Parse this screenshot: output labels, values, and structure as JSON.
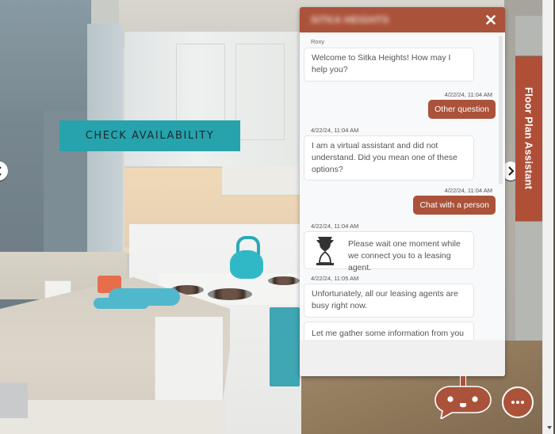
{
  "page": {
    "check_availability_label": "CHECK AVAILABILITY",
    "floor_plan_tab_label": "Floor Plan Assistant",
    "nav_prev_icon": "chevron-left-icon",
    "nav_next_icon": "chevron-right-icon"
  },
  "chat": {
    "title": "SITKA HEIGHTS",
    "close_icon": "close-icon",
    "colors": {
      "brand": "#ab523a",
      "accent": "#26a3ad"
    },
    "messages": [
      {
        "from": "bot",
        "sender": "Roxy",
        "text": "Welcome to Sitka Heights! How may I help you?"
      },
      {
        "from": "user",
        "timestamp": "4/22/24, 11:04 AM",
        "text": "Other question"
      },
      {
        "from": "bot",
        "timestamp": "4/22/24, 11:04 AM",
        "text": "I am a virtual assistant and did not understand. Did you mean one of these options?"
      },
      {
        "from": "user",
        "timestamp": "4/22/24, 11:04 AM",
        "text": "Chat with a person"
      },
      {
        "from": "bot",
        "timestamp": "4/22/24, 11:04 AM",
        "icon": "hourglass-icon",
        "text": "Please wait one moment while we connect you to a leasing agent."
      },
      {
        "from": "bot",
        "timestamp": "4/22/24, 11:05 AM",
        "text": "Unfortunately, all our leasing agents are busy right now."
      },
      {
        "from": "bot",
        "text": "Let me gather some information from you and"
      }
    ]
  },
  "launcher": {
    "chat_icon": "chat-bot-face-icon",
    "more_icon": "more-options-icon"
  }
}
